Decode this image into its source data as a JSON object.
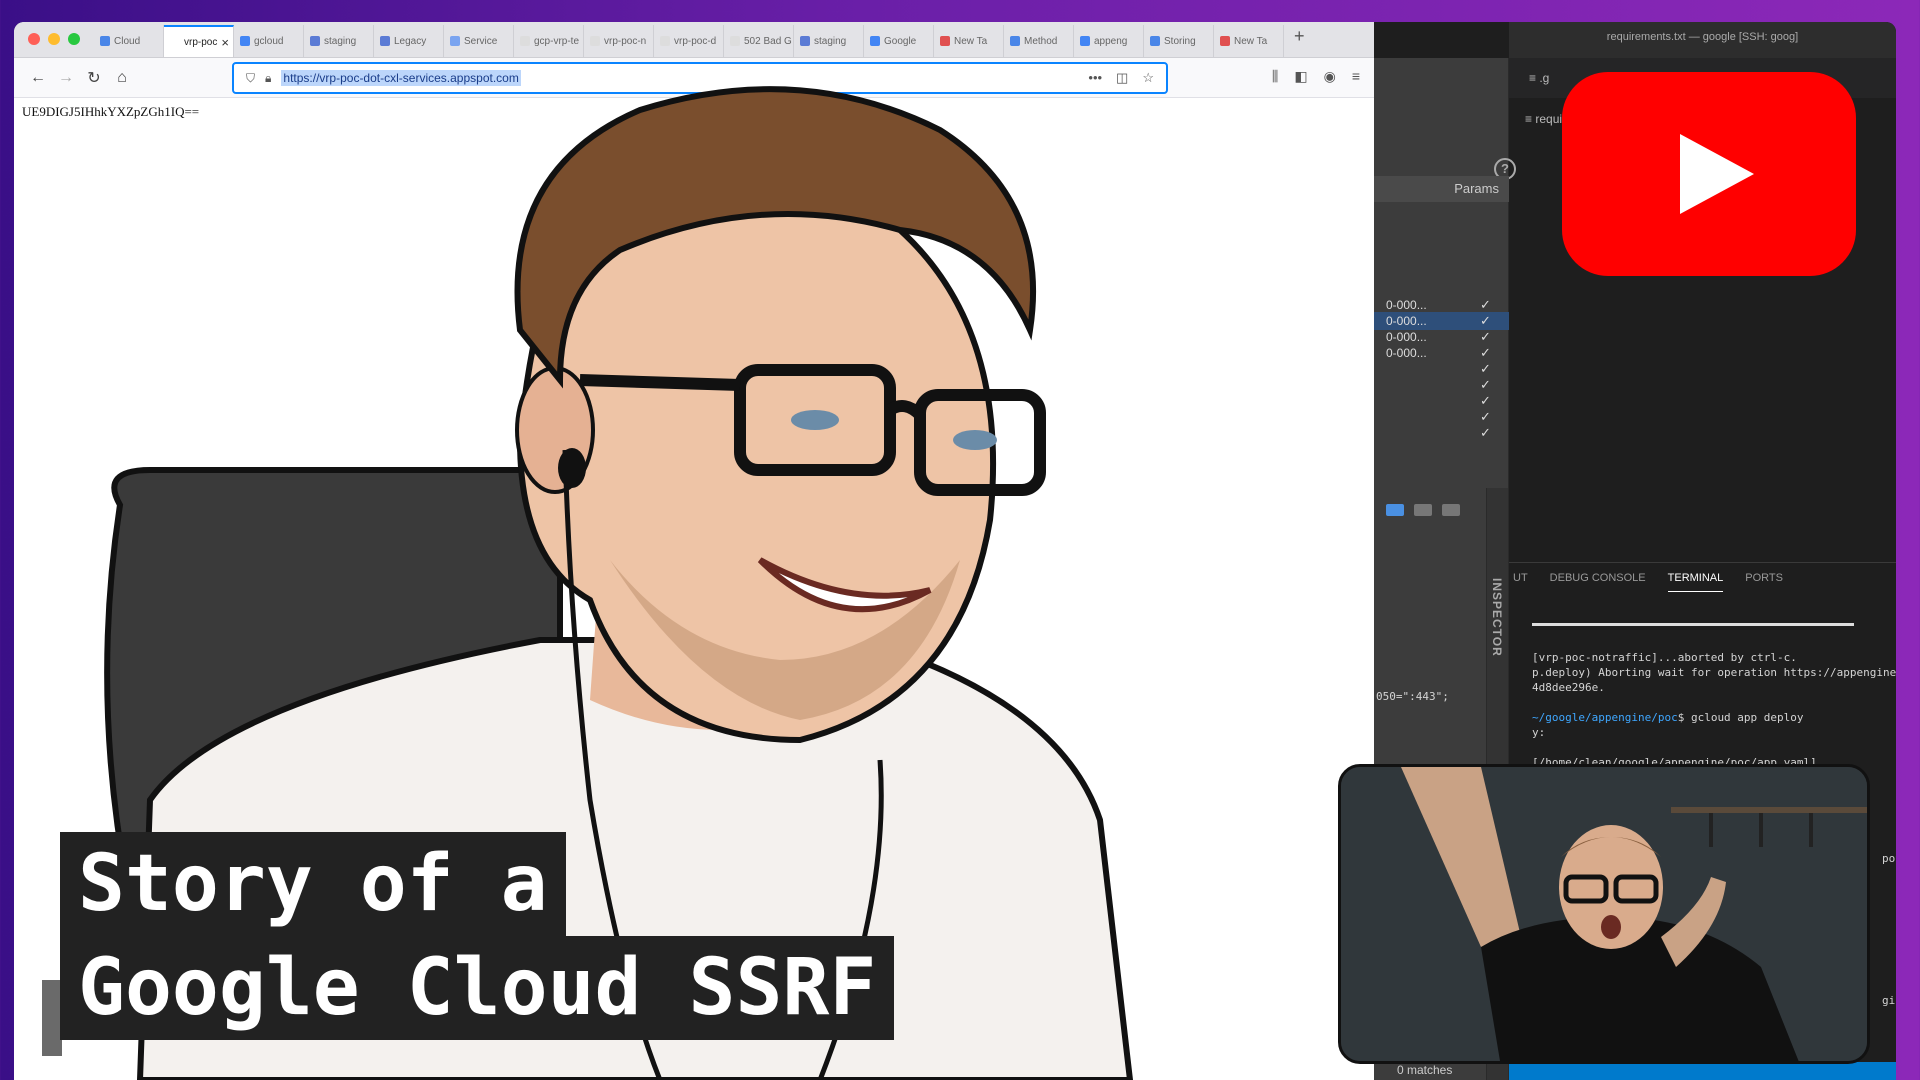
{
  "browser": {
    "tabs": [
      {
        "label": "Cloud",
        "fav": "#4a86e8"
      },
      {
        "label": "vrp-poc",
        "fav": "#ffffff",
        "active": true
      },
      {
        "label": "gcloud",
        "fav": "#4285f4"
      },
      {
        "label": "staging",
        "fav": "#5b7bd5"
      },
      {
        "label": "Legacy",
        "fav": "#5b7bd5"
      },
      {
        "label": "Service",
        "fav": "#7aa4f0"
      },
      {
        "label": "gcp-vrp-te",
        "fav": "#dddddd"
      },
      {
        "label": "vrp-poc-n",
        "fav": "#dddddd"
      },
      {
        "label": "vrp-poc-d",
        "fav": "#dddddd"
      },
      {
        "label": "502 Bad G",
        "fav": "#dddddd"
      },
      {
        "label": "staging",
        "fav": "#5b7bd5"
      },
      {
        "label": "Google",
        "fav": "#4285f4"
      },
      {
        "label": "New Ta",
        "fav": "#e05050"
      },
      {
        "label": "Method",
        "fav": "#4a86e8"
      },
      {
        "label": "appeng",
        "fav": "#4285f4"
      },
      {
        "label": "Storing",
        "fav": "#4a86e8"
      },
      {
        "label": "New Ta",
        "fav": "#e05050"
      }
    ],
    "url": "https://vrp-poc-dot-cxl-services.appspot.com",
    "page_text": "UE9DIGJ5IHhkYXZpZGh1IQ=="
  },
  "editor": {
    "window_title": "requirements.txt — google [SSH: goog]",
    "breadcrumb": "requi",
    "params_header": "Params",
    "inspector_label": "INSPECTOR",
    "requests": [
      {
        "id": "0-000...",
        "check": "✓",
        "selected": false
      },
      {
        "id": "0-000...",
        "check": "✓",
        "selected": true
      },
      {
        "id": "0-000...",
        "check": "✓",
        "selected": false
      },
      {
        "id": "0-000...",
        "check": "✓",
        "selected": false
      },
      {
        "id": "",
        "check": "✓",
        "selected": false
      },
      {
        "id": "",
        "check": "✓",
        "selected": false
      },
      {
        "id": "",
        "check": "✓",
        "selected": false
      },
      {
        "id": "",
        "check": "✓",
        "selected": false
      },
      {
        "id": "",
        "check": "✓",
        "selected": false
      }
    ],
    "code_fragment": "050=\":443\";",
    "panel_tabs": [
      "UT",
      "DEBUG CONSOLE",
      "TERMINAL",
      "PORTS"
    ],
    "terminal": {
      "line1": "[vrp-poc-notraffic]...aborted by ctrl-c.",
      "line2": "p.deploy) Aborting wait for operation https://appengine",
      "line3": "4d8dee296e.",
      "prompt_path": "~/google/appengine/poc",
      "command": "$ gcloud app deploy",
      "line5": "y:",
      "line6": "[/home/clean/google/appengine/poc/app.yaml]"
    },
    "side_fragments": [
      "pot.",
      "gine"
    ],
    "matches": "0 matches"
  },
  "overlay": {
    "title_line1": "Story of a",
    "title_line2": "Google Cloud SSRF"
  }
}
